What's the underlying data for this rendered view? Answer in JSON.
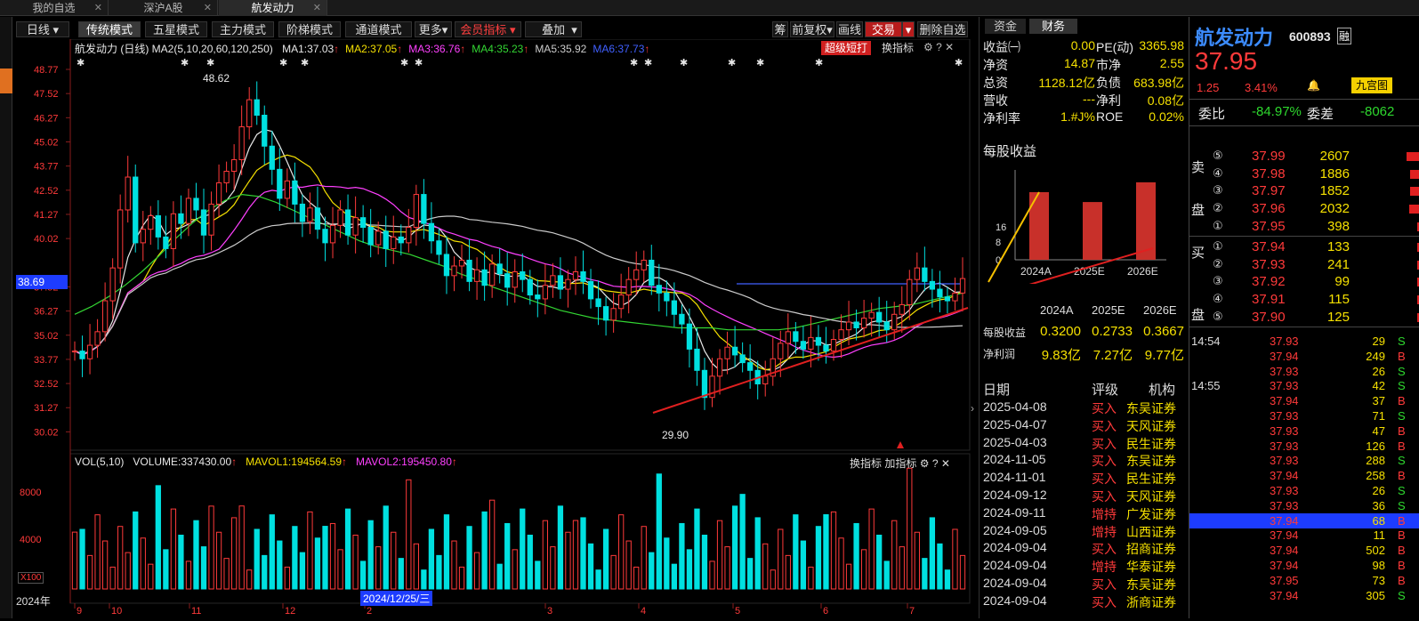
{
  "tabs": [
    {
      "label": "我的自选",
      "closable": true,
      "active": false
    },
    {
      "label": "深沪A股",
      "closable": true,
      "active": false
    },
    {
      "label": "航发动力",
      "closable": true,
      "active": true
    }
  ],
  "toolbar": {
    "period": "日线",
    "modes": [
      "传统模式",
      "五星模式",
      "主力模式",
      "阶梯模式",
      "通道模式",
      "更多"
    ],
    "member": "会员指标",
    "overlay": "叠加",
    "right": {
      "chou": "筹",
      "fuquan": "前复权",
      "huaxian": "画线",
      "trade": "交易",
      "del": "删除自选"
    }
  },
  "main": {
    "title": "航发动力 (日线)",
    "ma2": "MA2(5,10,20,60,120,250)",
    "ma": [
      {
        "label": "MA1:37.03",
        "arrow": "↑",
        "color": "#e8e8e8"
      },
      {
        "label": "MA2:37.05",
        "arrow": "↑",
        "color": "#f5e000"
      },
      {
        "label": "MA3:36.76",
        "arrow": "↑",
        "color": "#ff40ff"
      },
      {
        "label": "MA4:35.23",
        "arrow": "↑",
        "color": "#33d633"
      },
      {
        "label": "MA5:35.92",
        "arrow": "",
        "color": "#cccccc"
      },
      {
        "label": "MA6:37.73",
        "arrow": "↑",
        "color": "#4060ff"
      }
    ],
    "super_btn": "超级短打",
    "switch_btn": "换指标",
    "yticks": [
      "48.77",
      "47.52",
      "46.27",
      "45.02",
      "43.77",
      "42.52",
      "41.27",
      "40.02",
      "37.52",
      "36.27",
      "35.02",
      "33.77",
      "32.52",
      "31.27",
      "30.02"
    ],
    "current_price": "38.69",
    "high_label": "48.62",
    "low_label": "29.90"
  },
  "vol": {
    "label": "VOL(5,10)",
    "volume": "VOLUME:337430.00",
    "arrow": "↑",
    "mavol1": "MAVOL1:194564.59",
    "mavol2": "MAVOL2:195450.80",
    "yticks": [
      "8000",
      "4000"
    ],
    "unit": "X100",
    "btns": [
      "换指标",
      "加指标"
    ]
  },
  "xaxis": {
    "year": "2024年",
    "months": [
      "9",
      "10",
      "11",
      "12",
      "2",
      "3",
      "4",
      "5",
      "6",
      "7"
    ],
    "cursor_date": "2024/12/25/三"
  },
  "fin": {
    "tabs": [
      "资金",
      "财务"
    ],
    "rows": [
      [
        "收益㈠",
        "0.00",
        "PE(动)",
        "3365.98"
      ],
      [
        "净资",
        "14.87",
        "市净",
        "2.55"
      ],
      [
        "总资",
        "1128.12亿",
        "负债",
        "683.98亿"
      ],
      [
        "营收",
        "---",
        "净利",
        "0.08亿"
      ],
      [
        "净利率",
        "1.#J%",
        "ROE",
        "0.02%"
      ]
    ],
    "eps_title": "每股收益",
    "eps_axis": [
      "16",
      "8",
      "0"
    ],
    "eps_bars": [
      {
        "year": "2024A",
        "value": 0.32
      },
      {
        "year": "2025E",
        "value": 0.2733
      },
      {
        "year": "2026E",
        "value": 0.3667
      }
    ],
    "table_head": [
      "2024A",
      "2025E",
      "2026E"
    ],
    "table": [
      {
        "label": "每股收益",
        "vals": [
          "0.3200",
          "0.2733",
          "0.3667"
        ]
      },
      {
        "label": "净利润",
        "vals": [
          "9.83亿",
          "7.27亿",
          "9.77亿"
        ]
      }
    ],
    "rating_head": [
      "日期",
      "评级",
      "机构"
    ],
    "ratings": [
      [
        "2025-04-08",
        "买入",
        "东吴证券"
      ],
      [
        "2025-04-07",
        "买入",
        "天风证券"
      ],
      [
        "2025-04-03",
        "买入",
        "民生证券"
      ],
      [
        "2024-11-05",
        "买入",
        "东吴证券"
      ],
      [
        "2024-11-01",
        "买入",
        "民生证券"
      ],
      [
        "2024-09-12",
        "买入",
        "天风证券"
      ],
      [
        "2024-09-11",
        "增持",
        "广发证券"
      ],
      [
        "2024-09-05",
        "增持",
        "山西证券"
      ],
      [
        "2024-09-04",
        "买入",
        "招商证券"
      ],
      [
        "2024-09-04",
        "增持",
        "华泰证券"
      ],
      [
        "2024-09-04",
        "买入",
        "东吴证券"
      ],
      [
        "2024-09-04",
        "买入",
        "浙商证券"
      ]
    ]
  },
  "quote": {
    "name": "航发动力",
    "code": "600893",
    "badge": "融",
    "price": "37.95",
    "change": "1.25",
    "pct": "3.41%",
    "bell": "🔔",
    "btn": "九宫图",
    "weibi_label": "委比",
    "weibi": "-84.97%",
    "weicha_label": "委差",
    "weicha": "-8062",
    "sell_label": [
      "卖",
      "盘"
    ],
    "buy_label": [
      "买",
      "盘"
    ],
    "sell": [
      [
        "⑤",
        "37.99",
        "2607"
      ],
      [
        "④",
        "37.98",
        "1886"
      ],
      [
        "③",
        "37.97",
        "1852"
      ],
      [
        "②",
        "37.96",
        "2032"
      ],
      [
        "①",
        "37.95",
        "398"
      ]
    ],
    "buy": [
      [
        "①",
        "37.94",
        "133"
      ],
      [
        "②",
        "37.93",
        "241"
      ],
      [
        "③",
        "37.92",
        "99"
      ],
      [
        "④",
        "37.91",
        "115"
      ],
      [
        "⑤",
        "37.90",
        "125"
      ]
    ],
    "ticks": [
      [
        "14:54",
        "37.93",
        "29",
        "S"
      ],
      [
        "",
        "37.94",
        "249",
        "B"
      ],
      [
        "",
        "37.93",
        "26",
        "S"
      ],
      [
        "14:55",
        "37.93",
        "42",
        "S"
      ],
      [
        "",
        "37.94",
        "37",
        "B"
      ],
      [
        "",
        "37.93",
        "71",
        "S"
      ],
      [
        "",
        "37.93",
        "47",
        "B"
      ],
      [
        "",
        "37.93",
        "126",
        "B"
      ],
      [
        "",
        "37.93",
        "288",
        "S"
      ],
      [
        "",
        "37.94",
        "258",
        "B"
      ],
      [
        "",
        "37.93",
        "26",
        "S"
      ],
      [
        "",
        "37.93",
        "36",
        "S"
      ],
      [
        "",
        "37.94",
        "68",
        "B"
      ],
      [
        "",
        "37.94",
        "11",
        "B"
      ],
      [
        "",
        "37.94",
        "502",
        "B"
      ],
      [
        "",
        "37.94",
        "98",
        "B"
      ],
      [
        "",
        "37.95",
        "73",
        "B"
      ],
      [
        "",
        "37.94",
        "305",
        "S"
      ]
    ]
  },
  "colors": {
    "up": "#ff3a3a",
    "down": "#00e0e0",
    "bg": "#000000",
    "accent": "#ff3a3a"
  },
  "chart_data": {
    "type": "candlestick",
    "ylim": [
      29.9,
      48.77
    ],
    "closes": [
      34.2,
      33.8,
      34.5,
      35.2,
      36.8,
      38.5,
      41.5,
      43.2,
      39.8,
      40.5,
      41.2,
      40.1,
      39.5,
      41.3,
      40.8,
      42.1,
      41.5,
      40.2,
      41.8,
      42.9,
      43.5,
      44.1,
      45.8,
      47.2,
      46.4,
      44.8,
      43.6,
      42.1,
      43.0,
      41.8,
      40.9,
      41.6,
      40.5,
      39.8,
      40.7,
      41.5,
      40.2,
      41.1,
      40.6,
      39.7,
      40.4,
      39.5,
      40.1,
      39.8,
      40.6,
      42.3,
      40.8,
      39.9,
      39.2,
      38.1,
      38.6,
      38.9,
      37.8,
      38.4,
      37.6,
      38.7,
      38.2,
      37.5,
      38.3,
      37.9,
      37.1,
      36.9,
      37.6,
      38.1,
      37.4,
      37.9,
      38.3,
      37.8,
      36.9,
      36.5,
      35.8,
      36.4,
      37.1,
      37.9,
      38.4,
      38.9,
      37.6,
      37.2,
      36.8,
      36.1,
      35.6,
      34.3,
      33.2,
      31.8,
      32.9,
      33.8,
      34.4,
      34.0,
      33.6,
      33.2,
      32.5,
      32.9,
      33.8,
      34.6,
      35.2,
      34.7,
      34.3,
      34.9,
      34.5,
      34.2,
      34.8,
      35.3,
      35.7,
      35.4,
      35.9,
      36.2,
      35.7,
      35.3,
      36.1,
      36.6,
      37.9,
      38.5,
      37.8,
      37.4,
      37.0,
      36.8,
      37.2,
      37.95
    ],
    "ma20": [
      36.1,
      36.5,
      37.0,
      37.6,
      38.3,
      39.1,
      40.0,
      40.8,
      41.5,
      42.0,
      42.3,
      42.2,
      41.9,
      41.5,
      41.1,
      40.7,
      40.3,
      39.9,
      39.6,
      39.4,
      39.2,
      38.9,
      38.6,
      38.2,
      37.9,
      37.5,
      37.2,
      36.9,
      36.6,
      36.3,
      36.1,
      35.9,
      35.8,
      35.7,
      35.6,
      35.5,
      35.4,
      35.4,
      35.4,
      35.3,
      35.3,
      35.3,
      35.3,
      35.4,
      35.6,
      35.8,
      36.0,
      36.2,
      36.4,
      36.5,
      36.6,
      36.8,
      37.0,
      37.2
    ]
  }
}
